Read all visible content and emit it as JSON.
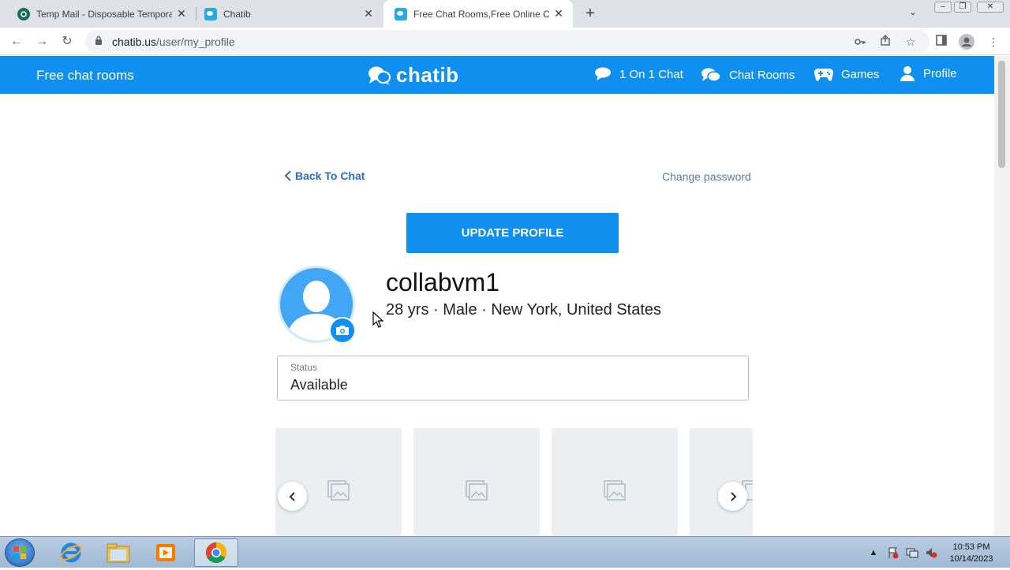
{
  "browser": {
    "tabs": [
      {
        "title": "Temp Mail - Disposable Tempora",
        "favicon": "tempmail-icon",
        "active": false
      },
      {
        "title": "Chatib",
        "favicon": "chatib-icon",
        "active": false
      },
      {
        "title": "Free Chat Rooms,Free Online Cha",
        "favicon": "chatib-icon",
        "active": true
      }
    ],
    "url_host": "chatib.us",
    "url_path": "/user/my_profile"
  },
  "site": {
    "left_title": "Free chat rooms",
    "logo_text": "chatib",
    "nav": [
      {
        "label": "1 On 1 Chat",
        "icon": "chat-bubble-icon"
      },
      {
        "label": "Chat Rooms",
        "icon": "chat-rooms-icon"
      },
      {
        "label": "Games",
        "icon": "gamepad-icon"
      },
      {
        "label": "Profile",
        "icon": "user-icon"
      }
    ],
    "accent_color": "#0f8ff0"
  },
  "profile": {
    "back_label": "Back To Chat",
    "change_password_label": "Change password",
    "update_button_label": "UPDATE PROFILE",
    "username": "collabvm1",
    "info": "28 yrs · Male · New York, United States",
    "status_label": "Status",
    "status_value": "Available"
  },
  "taskbar": {
    "time": "10:53 PM",
    "date": "10/14/2023"
  }
}
